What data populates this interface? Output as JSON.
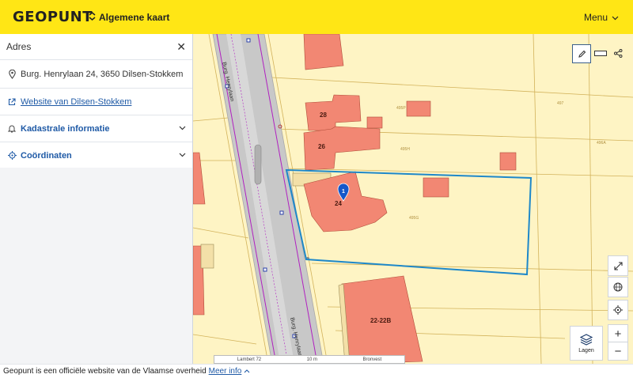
{
  "header": {
    "logo": "GEOPUNT",
    "map_select": "Algemene kaart",
    "menu": "Menu"
  },
  "panel": {
    "title": "Adres",
    "address": "Burg. Henrylaan 24, 3650 Dilsen-Stokkem",
    "website_link": "Website van Dilsen-Stokkem",
    "cadastral": "Kadastrale informatie",
    "coordinates": "Coördinaten"
  },
  "map": {
    "street_name_top": "Burg. Henrylaan",
    "street_name_bottom": "Burg. Henrylaan",
    "house_labels": [
      "28",
      "26",
      "24",
      "22-22B"
    ],
    "parcel_labels": [
      "495P",
      "495H",
      "495G",
      "497",
      "496A"
    ],
    "pin_number": "1",
    "layers_label": "Lagen",
    "scale": {
      "crs": "Lambert 72",
      "distance": "10 m",
      "source": "Bronvest"
    }
  },
  "footer": {
    "text": "Geopunt is een officiële website van de Vlaamse overheid",
    "more": "Meer info"
  },
  "colors": {
    "topbar": "#ffe615",
    "parcel": "#fef4c4",
    "building": "#f28773",
    "selection": "#1e88c9",
    "link": "#1f5aa6"
  }
}
